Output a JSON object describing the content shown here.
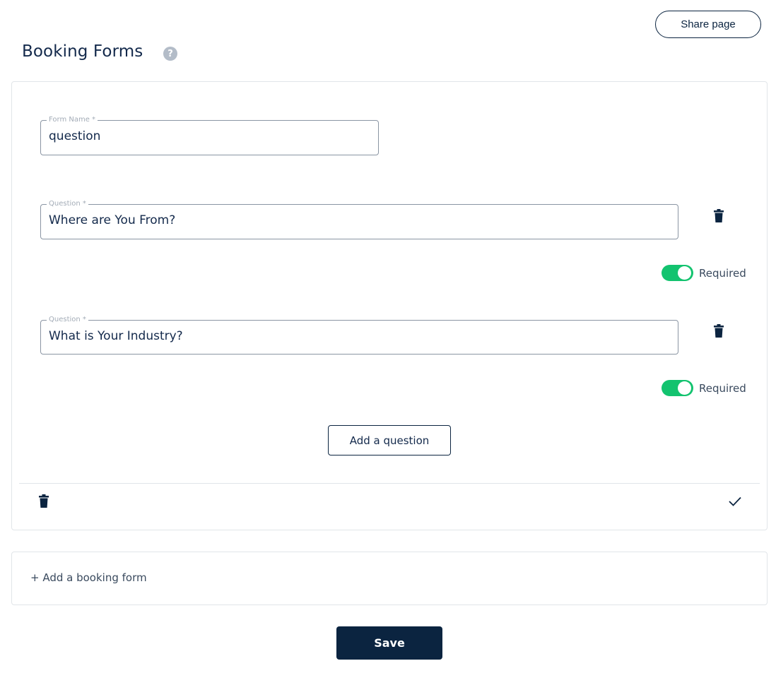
{
  "header": {
    "title": "Booking Forms",
    "help_icon": "question-circle-icon",
    "share_label": "Share page"
  },
  "form": {
    "name_label": "Form Name *",
    "name_value": "question",
    "questions": [
      {
        "label": "Question *",
        "value": "Where are You From?",
        "required": true,
        "required_label": "Required"
      },
      {
        "label": "Question *",
        "value": "What is Your Industry?",
        "required": true,
        "required_label": "Required"
      }
    ],
    "add_question_label": "Add a question",
    "delete_icon": "trash-icon",
    "confirm_icon": "check-icon"
  },
  "add_booking_form_label": "+ Add a booking form",
  "save_label": "Save",
  "colors": {
    "primary": "#0b2440",
    "toggle_on": "#13c36f",
    "border": "#e1e5e9"
  }
}
